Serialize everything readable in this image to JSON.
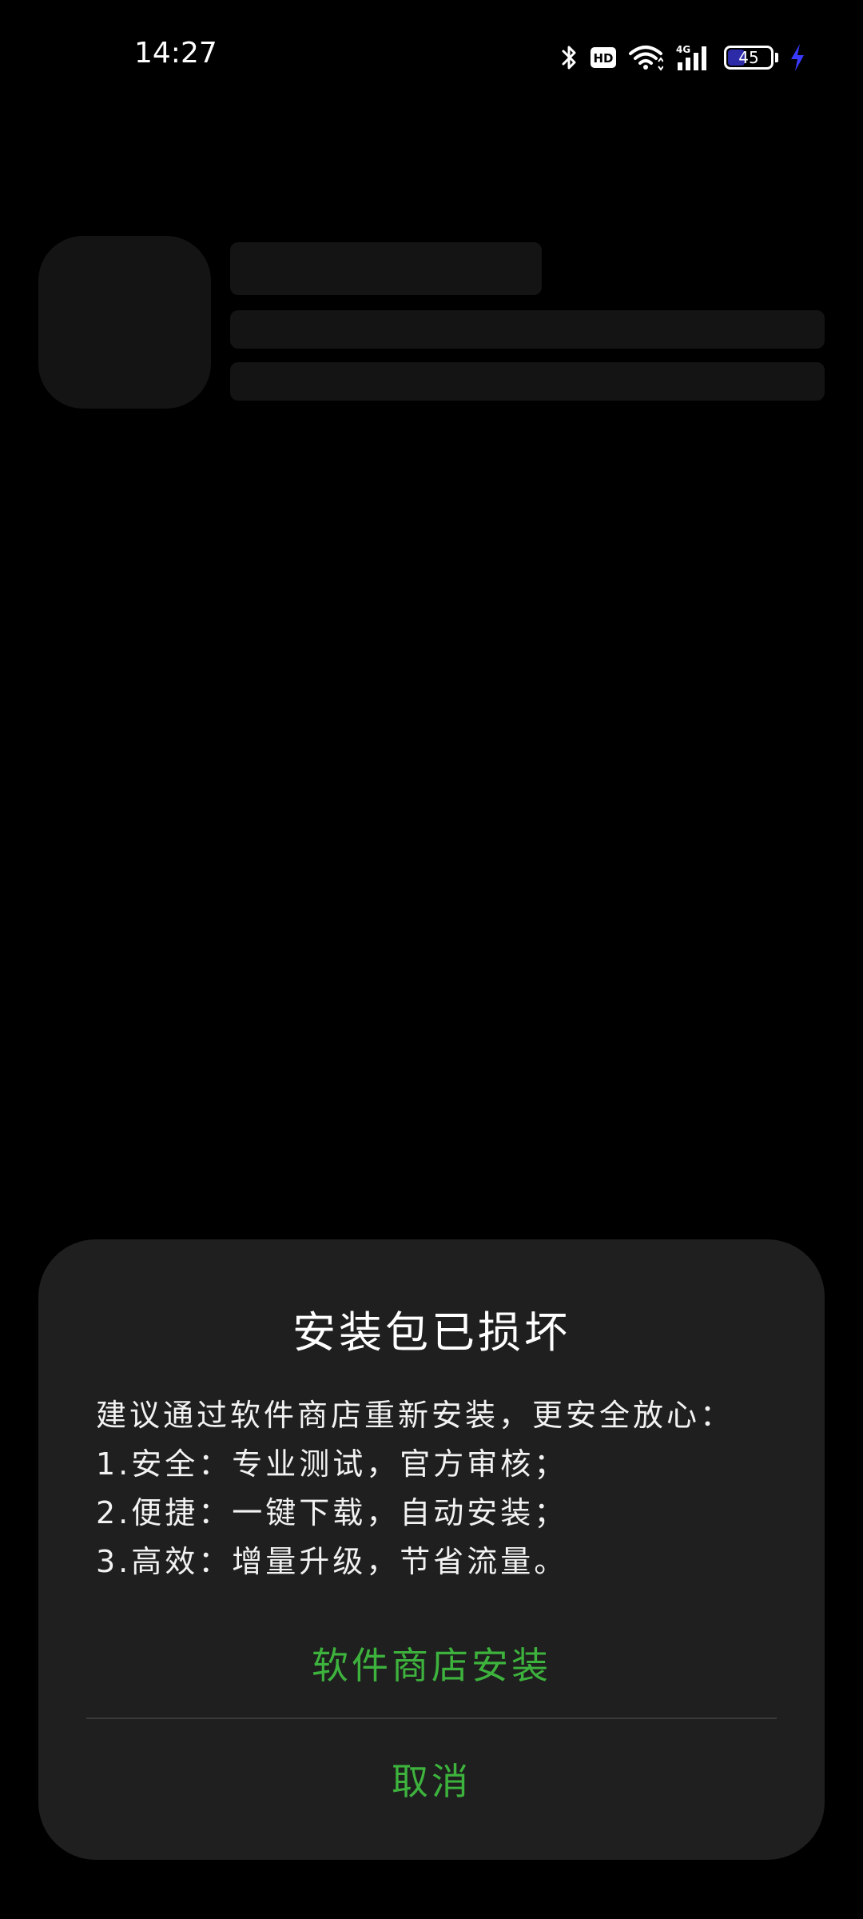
{
  "status_bar": {
    "time": "14:27",
    "hd_label": "HD",
    "network_label": "4G",
    "battery_level": "45",
    "battery_fraction": 0.45,
    "icons": [
      "bluetooth-icon",
      "hd-icon",
      "wifi-icon",
      "signal-4g-icon",
      "battery-icon",
      "charging-icon"
    ],
    "charging_color": "#3a3aff"
  },
  "dialog": {
    "title": "安装包已损坏",
    "body_lines": [
      "建议通过软件商店重新安装，更安全放心：",
      "1.安全：专业测试，官方审核；",
      "2.便捷：一键下载，自动安装；",
      "3.高效：增量升级，节省流量。"
    ],
    "store_button": "软件商店安装",
    "cancel_button": "取消",
    "accent_color": "#3db33d"
  }
}
